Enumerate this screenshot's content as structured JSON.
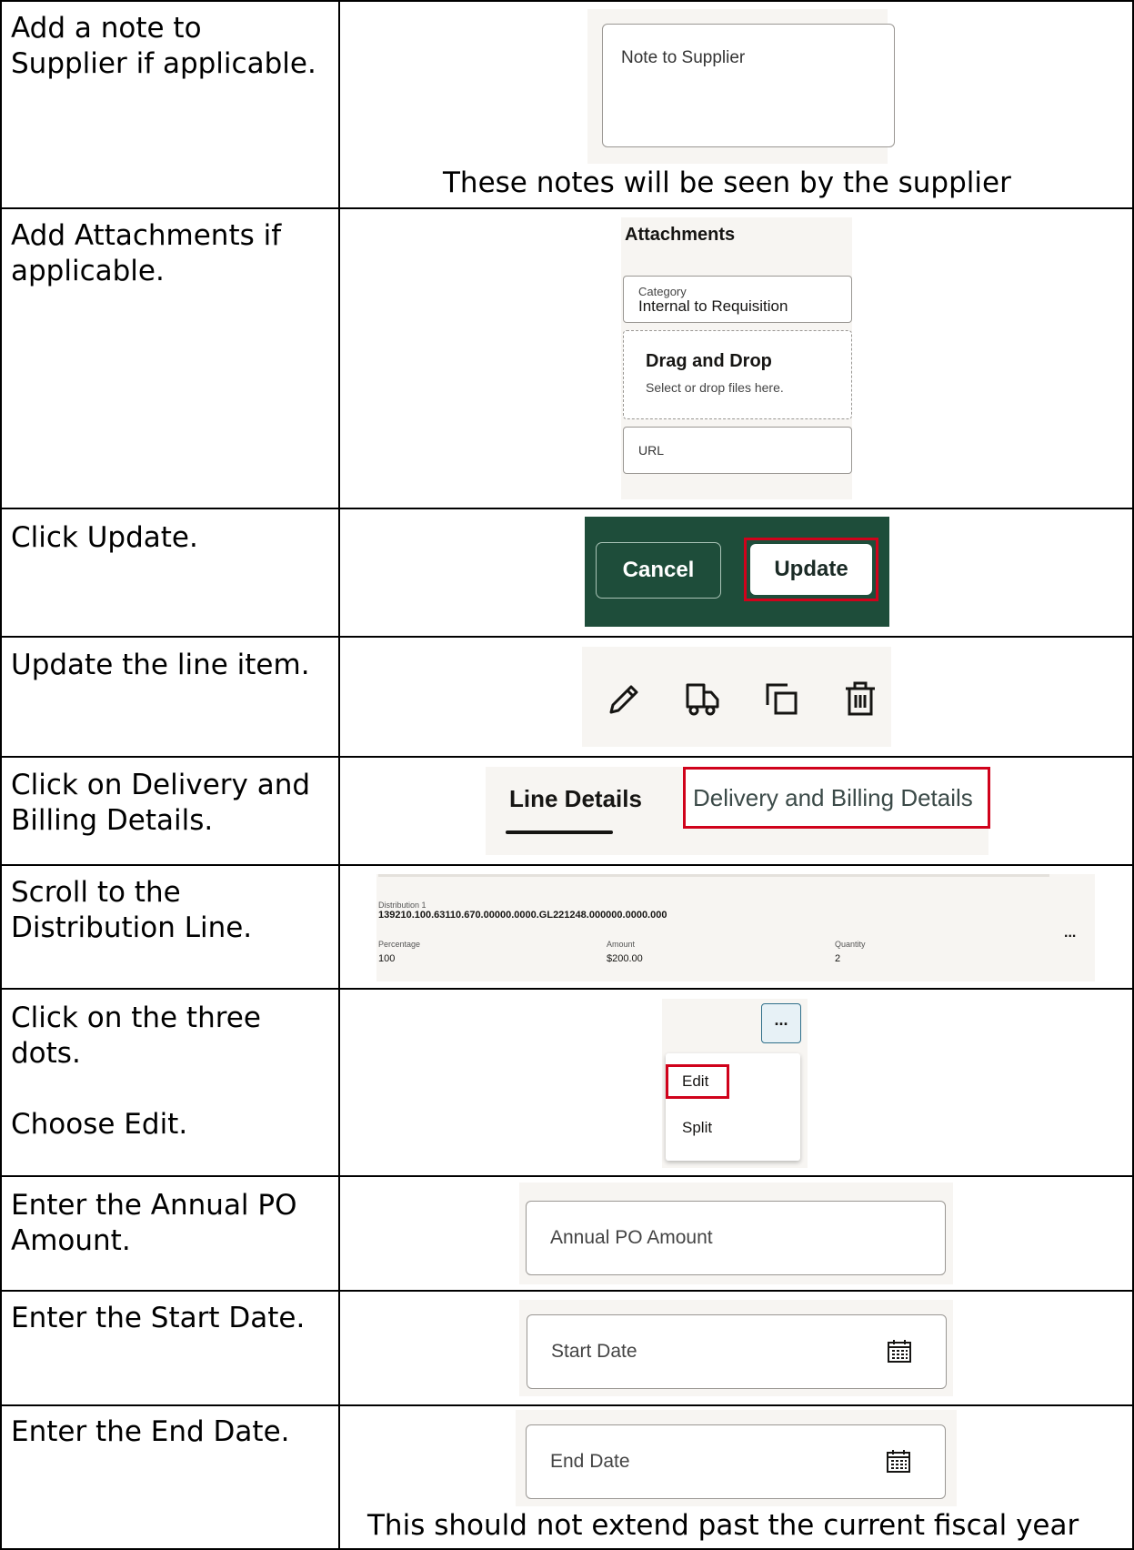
{
  "rows": [
    {
      "step": "Add a note to\nSupplier if applicable.",
      "shot": {
        "label": "Note to Supplier"
      },
      "caption": "These notes will be seen by the supplier"
    },
    {
      "step": "Add Attachments if\napplicable.",
      "shot": {
        "title": "Attachments",
        "category_label": "Category",
        "category_value": "Internal to Requisition",
        "drop_title": "Drag and Drop",
        "drop_hint": "Select or drop files here.",
        "url_label": "URL"
      }
    },
    {
      "step": "Click Update.",
      "shot": {
        "cancel_label": "Cancel",
        "update_label": "Update"
      }
    },
    {
      "step": "Update the line item.",
      "shot": {
        "icons": [
          "pencil-icon",
          "truck-icon",
          "duplicate-icon",
          "trash-icon"
        ]
      }
    },
    {
      "step": "Click on Delivery and\nBilling Details.",
      "shot": {
        "tab_line": "Line Details",
        "tab_delivery": "Delivery and Billing Details"
      }
    },
    {
      "step": "Scroll to the\nDistribution Line.",
      "shot": {
        "dist_label": "Distribution 1",
        "dist_account": "139210.100.63110.670.00000.0000.GL221248.000000.0000.000",
        "pct_label": "Percentage",
        "pct_value": "100",
        "amount_label": "Amount",
        "amount_value": "$200.00",
        "qty_label": "Quantity",
        "qty_value": "2",
        "more_label": "..."
      }
    },
    {
      "step": "Click on the three\ndots.\n\nChoose Edit.",
      "shot": {
        "more_label": "...",
        "menu": [
          "Edit",
          "Split"
        ]
      }
    },
    {
      "step": "Enter the Annual PO\nAmount.",
      "shot": {
        "placeholder": "Annual PO Amount"
      }
    },
    {
      "step": "Enter the Start Date.",
      "shot": {
        "placeholder": "Start Date"
      }
    },
    {
      "step": "Enter the End Date.",
      "shot": {
        "placeholder": "End Date"
      },
      "caption": "This should not extend past the current fiscal year"
    }
  ],
  "colors": {
    "highlight": "#d0021b",
    "green": "#1e4d3a",
    "cream": "#f7f5f2"
  }
}
